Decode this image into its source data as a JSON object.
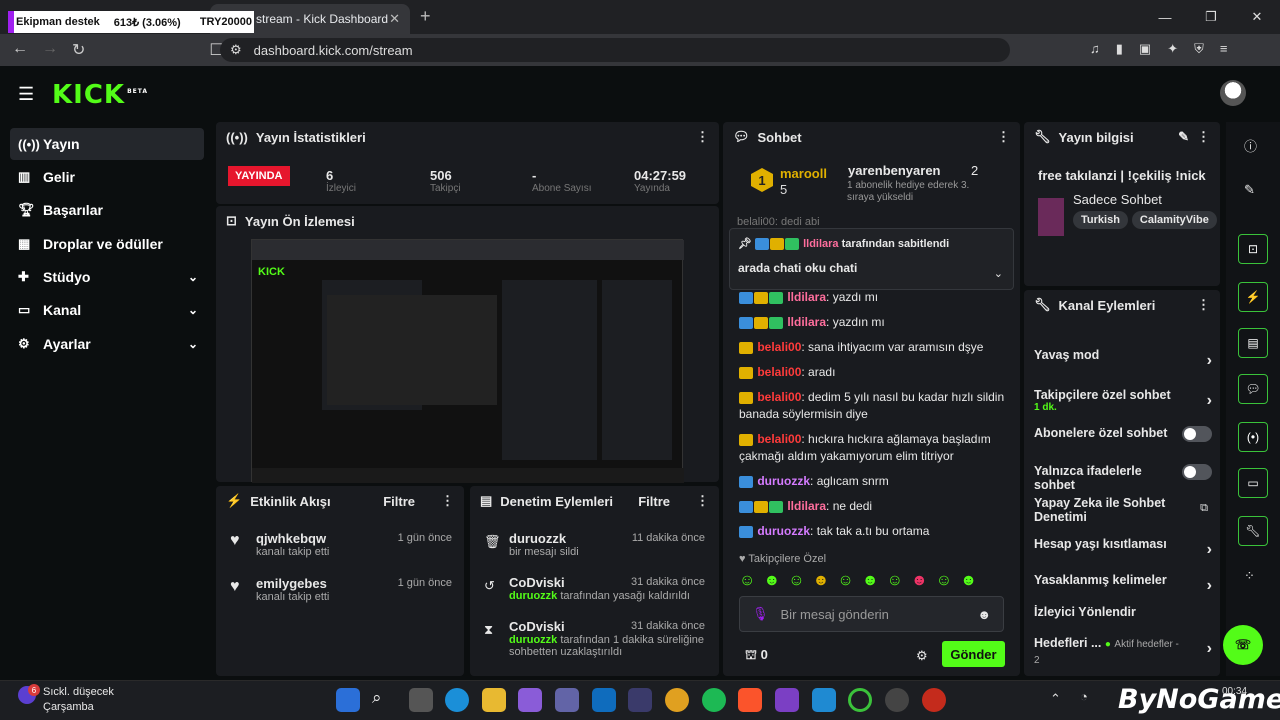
{
  "browser": {
    "ticker_name": "Ekipman destek",
    "ticker_value": "613₺ (3.06%)",
    "ticker_target": "TRY20000",
    "tab_title": "stream - Kick Dashboard",
    "url": "dashboard.kick.com/stream"
  },
  "sidebar": {
    "items": [
      {
        "label": "Yayın"
      },
      {
        "label": "Gelir"
      },
      {
        "label": "Başarılar"
      },
      {
        "label": "Droplar ve ödüller"
      },
      {
        "label": "Stüdyo"
      },
      {
        "label": "Kanal"
      },
      {
        "label": "Ayarlar"
      }
    ]
  },
  "stats": {
    "title": "Yayın İstatistikleri",
    "status": "YAYINDA",
    "viewers": "6",
    "viewers_label": "İzleyici",
    "followers": "506",
    "followers_label": "Takipçi",
    "subs": "-",
    "subs_label": "Abone Sayısı",
    "uptime": "04:27:59",
    "uptime_label": "Yayında"
  },
  "preview": {
    "title": "Yayın Ön İzlemesi"
  },
  "activity": {
    "title": "Etkinlik Akışı",
    "filter": "Filtre",
    "items": [
      {
        "user": "qjwhkebqw",
        "action": "kanalı takip etti",
        "time": "1 gün önce"
      },
      {
        "user": "emilygebes",
        "action": "kanalı takip etti",
        "time": "1 gün önce"
      }
    ]
  },
  "moderation": {
    "title": "Denetim Eylemleri",
    "filter": "Filtre",
    "items": [
      {
        "user": "duruozzk",
        "action": "bir mesajı sildi",
        "time": "11 dakika önce",
        "actor": ""
      },
      {
        "user": "CoDviski",
        "actor": "duruozzk",
        "action": "tarafından yasağı kaldırıldı",
        "time": "31 dakika önce"
      },
      {
        "user": "CoDviski",
        "actor": "duruozzk",
        "action": "tarafından 1 dakika süreliğine sohbetten uzaklaştırıldı",
        "time": "31 dakika önce"
      }
    ]
  },
  "chat": {
    "title": "Sohbet",
    "top_user": "marooll",
    "top_rank": "1",
    "top_count": "5",
    "gifter": "yarenbenyaren",
    "gifter_count": "2",
    "gift_text": "1 abonelik hediye ederek 3. sıraya yükseldi",
    "partial_line": "belali00: dedi abi",
    "pinned_by": "lldilara",
    "pinned_suffix": "tarafından sabitlendi",
    "pinned_msg": "arada chati oku chati",
    "messages": [
      {
        "user": "lldilara",
        "text": "yazdı mı"
      },
      {
        "user": "lldilara",
        "text": "yazdın mı"
      },
      {
        "user": "belali00",
        "text": "sana ihtiyacım var aramısın dşye"
      },
      {
        "user": "belali00",
        "text": "aradı"
      },
      {
        "user": "belali00",
        "text": "dedim 5 yılı nasıl bu kadar hızlı sildin banada söylermisin diye"
      },
      {
        "user": "belali00",
        "text": "hıckıra hıckıra ağlamaya başladım çakmağı aldım yakamıyorum elim titriyor"
      },
      {
        "user": "duruozzk",
        "text": "aglıcam snrm"
      },
      {
        "user": "lldilara",
        "text": "ne dedi"
      },
      {
        "user": "duruozzk",
        "text": "tak tak a.tı bu ortama"
      }
    ],
    "followers_only": "Takipçilere Özel",
    "input_placeholder": "Bir mesaj gönderin",
    "points": "0",
    "send": "Gönder"
  },
  "info": {
    "title": "Yayın bilgisi",
    "stream_title": "free takılanzi | !çekiliş !nick",
    "category": "Sadece Sohbet",
    "tags": [
      "Turkish",
      "CalamityVibe"
    ]
  },
  "actions": {
    "title": "Kanal Eylemleri",
    "items": [
      {
        "label": "Yavaş mod",
        "sub": "",
        "kind": "arrow"
      },
      {
        "label": "Takipçilere özel sohbet",
        "sub": "1 dk.",
        "kind": "arrow"
      },
      {
        "label": "Abonelere özel sohbet",
        "sub": "",
        "kind": "toggle"
      },
      {
        "label": "Yalnızca ifadelerle sohbet",
        "sub": "",
        "kind": "toggle"
      },
      {
        "label": "Yapay Zeka ile Sohbet Denetimi",
        "sub": "",
        "kind": "ext"
      },
      {
        "label": "Hesap yaşı kısıtlaması",
        "sub": "",
        "kind": "arrow"
      },
      {
        "label": "Yasaklanmış kelimeler",
        "sub": "",
        "kind": "arrow"
      },
      {
        "label": "İzleyici Yönlendir",
        "sub": "",
        "kind": "none"
      },
      {
        "label": "Hedefleri ...",
        "sub": "Aktif hedefler - 2",
        "kind": "arrow"
      }
    ]
  },
  "taskbar": {
    "weather_badge": "6",
    "weather_title": "Sıckl. düşecek",
    "weather_day": "Çarşamba",
    "clock": "00:34",
    "watermark": "ByNoGame"
  }
}
